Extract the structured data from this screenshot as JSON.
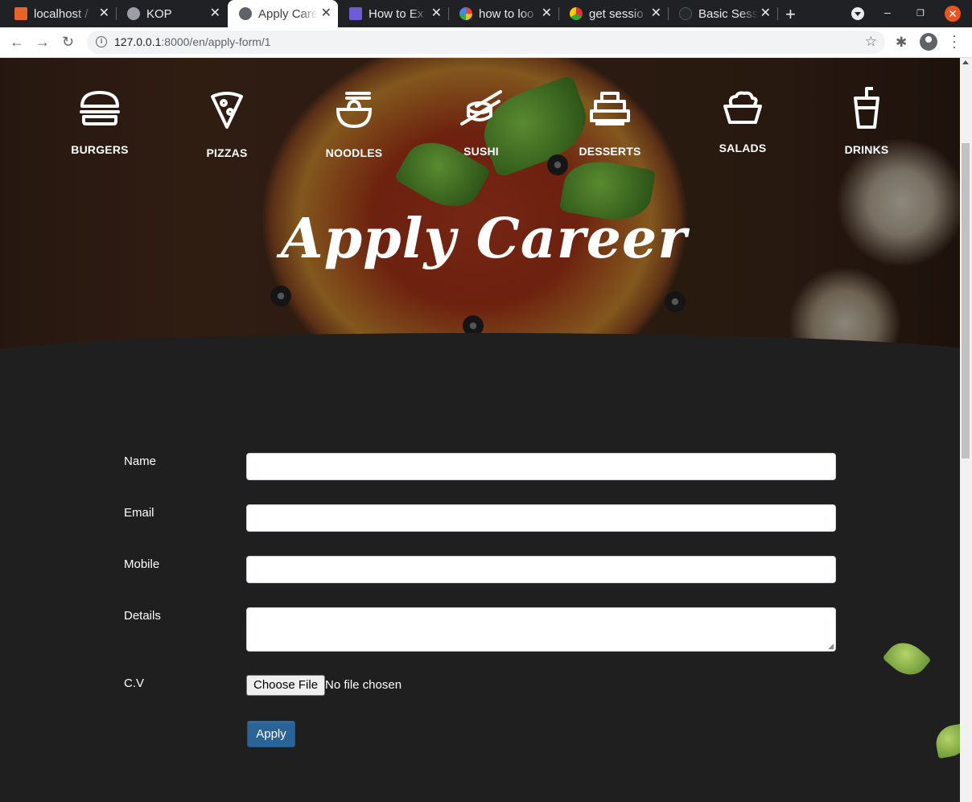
{
  "browser": {
    "tabs": [
      {
        "title": "localhost /",
        "favicon_color": "#e8622b"
      },
      {
        "title": "KOP",
        "favicon_color": "#9aa0a6"
      },
      {
        "title": "Apply Care",
        "favicon_color": "#5f6368"
      },
      {
        "title": "How to Ex",
        "favicon_color": "#6f5bd6"
      },
      {
        "title": "how to loo",
        "favicon_color": "#4285f4"
      },
      {
        "title": "get sessio",
        "favicon_color": "#d33"
      },
      {
        "title": "Basic Sess",
        "favicon_color": "#24292e"
      }
    ],
    "url_host": "127.0.0.1",
    "url_rest": ":8000/en/apply-form/1"
  },
  "categories": [
    {
      "label": "BURGERS",
      "icon": "burger-icon"
    },
    {
      "label": "PIZZAS",
      "icon": "pizza-icon"
    },
    {
      "label": "NOODLES",
      "icon": "noodles-icon"
    },
    {
      "label": "SUSHI",
      "icon": "sushi-icon"
    },
    {
      "label": "DESSERTS",
      "icon": "cake-icon"
    },
    {
      "label": "SALADS",
      "icon": "salad-icon"
    },
    {
      "label": "DRINKS",
      "icon": "drink-icon"
    }
  ],
  "page_title": "Apply Career",
  "form": {
    "name_label": "Name",
    "email_label": "Email",
    "mobile_label": "Mobile",
    "details_label": "Details",
    "cv_label": "C.V",
    "choose_file": "Choose File",
    "no_file": "No file chosen",
    "apply": "Apply"
  },
  "colors": {
    "page_bg": "#1f1f1f",
    "apply_button": "#2a6496",
    "close_button": "#e95420"
  }
}
